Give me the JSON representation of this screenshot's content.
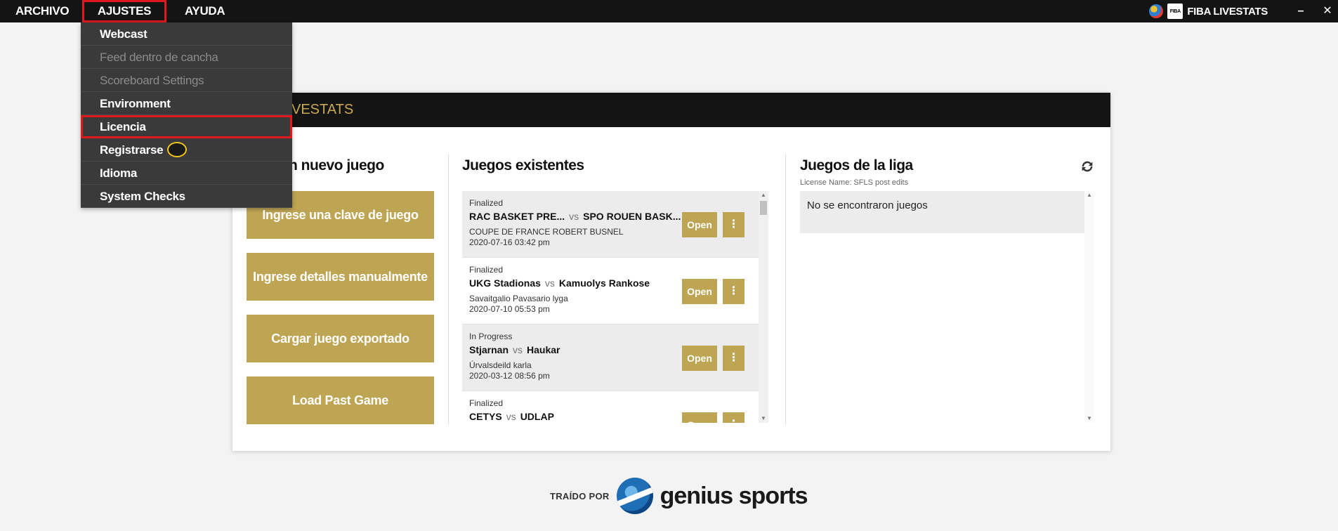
{
  "menubar": {
    "items": [
      "ARCHIVO",
      "AJUSTES",
      "AYUDA"
    ],
    "brand_small": "FIBA",
    "brand": "FIBA LIVESTATS",
    "minimize": "–",
    "close": "✕"
  },
  "dropdown": {
    "items": [
      {
        "label": "Webcast"
      },
      {
        "label": "Feed dentro de cancha"
      },
      {
        "label": "Scoreboard Settings"
      },
      {
        "label": "Environment"
      },
      {
        "label": "Licencia"
      },
      {
        "label": "Registrarse"
      },
      {
        "label": "Idioma"
      },
      {
        "label": "System Checks"
      }
    ]
  },
  "card": {
    "header": "VESTATS",
    "new_game_title": "n nuevo juego",
    "buttons": [
      "Ingrese una clave de juego",
      "Ingrese detalles manualmente",
      "Cargar juego exportado",
      "Load Past Game"
    ],
    "existing_title": "Juegos existentes",
    "games": [
      {
        "status": "Finalized",
        "home": "RAC BASKET PRE...",
        "vs": "vs",
        "away": "SPO ROUEN BASK...",
        "league": "COUPE DE FRANCE ROBERT BUSNEL",
        "date": "2020-07-16 03:42 pm",
        "open": "Open",
        "more": "⋮"
      },
      {
        "status": "Finalized",
        "home": "UKG Stadionas",
        "vs": "vs",
        "away": "Kamuolys Rankose",
        "league": "Savaitgalio Pavasario lyga",
        "date": "2020-07-10 05:53 pm",
        "open": "Open",
        "more": "⋮"
      },
      {
        "status": "In Progress",
        "home": "Stjarnan",
        "vs": "vs",
        "away": "Haukar",
        "league": "Úrvalsdeild karla",
        "date": "2020-03-12 08:56 pm",
        "open": "Open",
        "more": "⋮"
      },
      {
        "status": "Finalized",
        "home": "CETYS",
        "vs": "vs",
        "away": "UDLAP",
        "league": "",
        "date": "",
        "open": "Open",
        "more": "⋮"
      }
    ],
    "league_title": "Juegos de la liga",
    "license_label": "License Name: SFLS post edits",
    "no_games": "No se encontraron juegos",
    "refresh_icon": "refresh-icon"
  },
  "footer": {
    "label": "TRAÍDO POR",
    "brand": "genius sports"
  }
}
